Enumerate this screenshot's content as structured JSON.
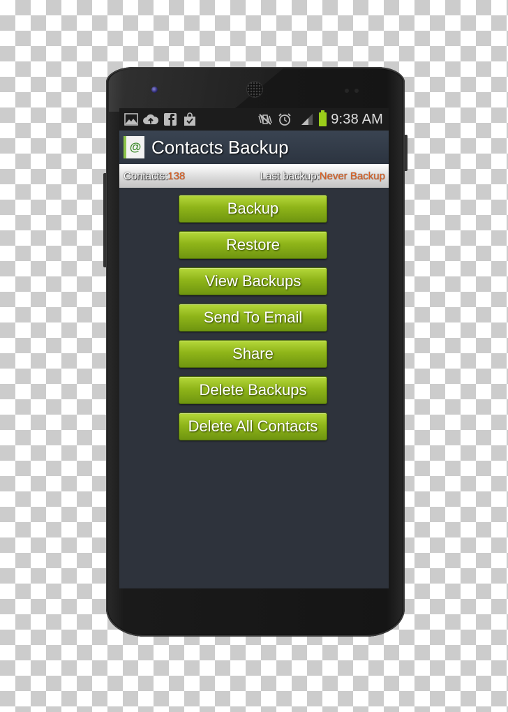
{
  "statusbar": {
    "left_icons": [
      "gallery-icon",
      "cloud-upload-icon",
      "facebook-icon",
      "shopping-bag-check-icon"
    ],
    "right_icons": [
      "mute-vibrate-icon",
      "alarm-clock-icon",
      "signal-icon",
      "battery-icon"
    ],
    "time": "9:38 AM"
  },
  "app": {
    "title": "Contacts Backup",
    "icon_glyph": "@"
  },
  "info": {
    "contacts_label": "Contacts:",
    "contacts_value": "138",
    "last_backup_label": "Last backup:",
    "last_backup_value": "Never Backup"
  },
  "buttons": [
    {
      "label": "Backup"
    },
    {
      "label": "Restore"
    },
    {
      "label": "View Backups"
    },
    {
      "label": "Send To Email"
    },
    {
      "label": "Share"
    },
    {
      "label": "Delete Backups"
    },
    {
      "label": "Delete All Contacts"
    }
  ],
  "colors": {
    "accent_green": "#8fb519",
    "value_orange": "#e06020",
    "screen_bg": "#2e333c",
    "battery_green": "#9acd1a"
  }
}
